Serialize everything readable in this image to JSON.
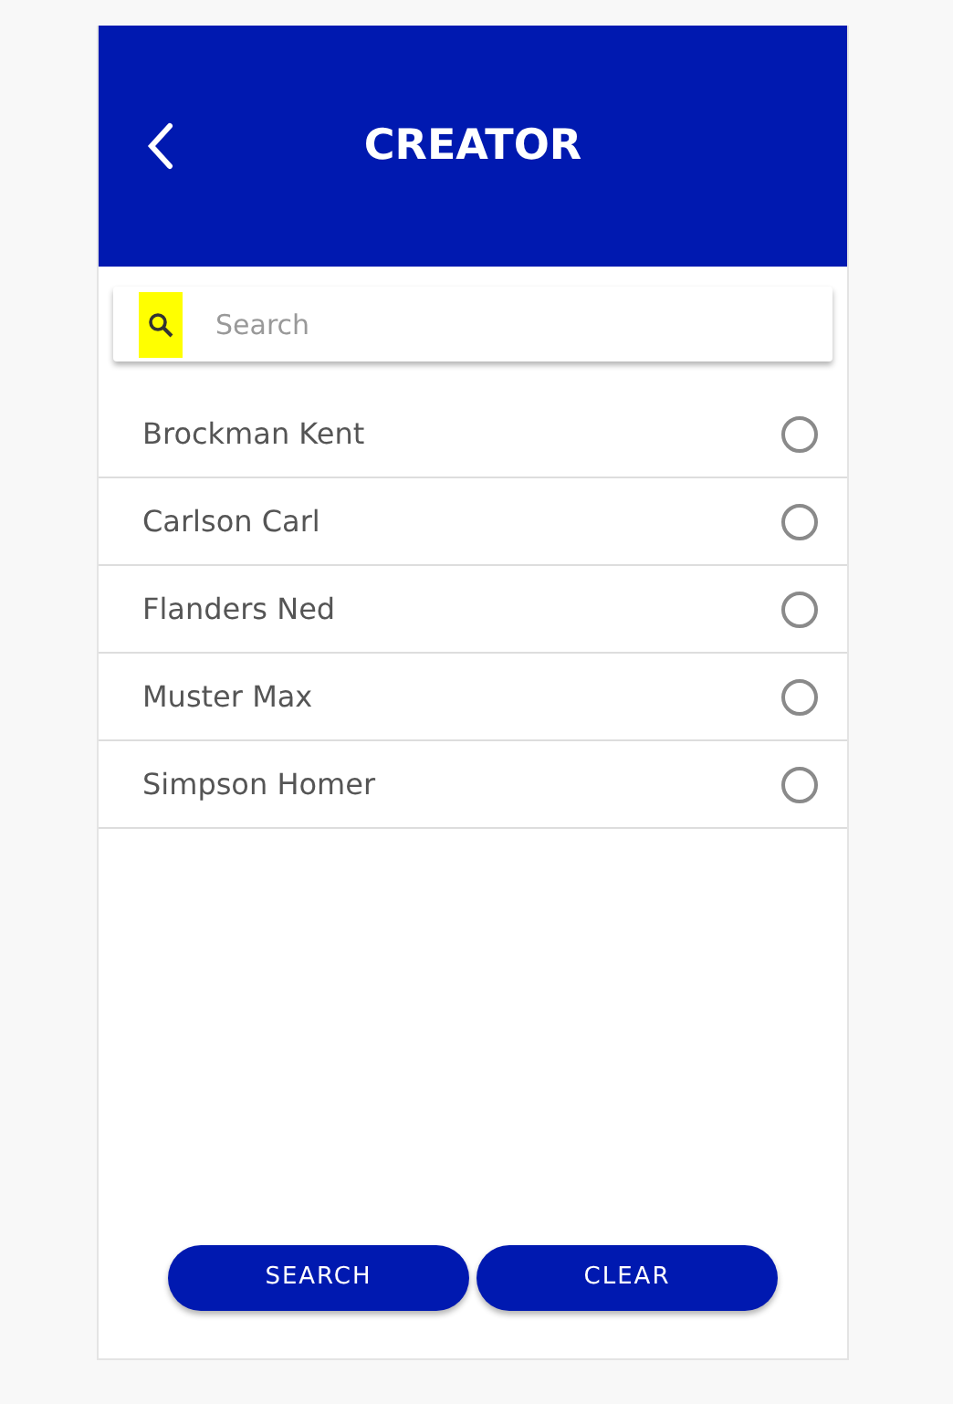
{
  "header": {
    "title": "CREATOR"
  },
  "search": {
    "placeholder": "Search",
    "icon_highlighted": true
  },
  "items": [
    {
      "name": "Brockman Kent",
      "selected": false
    },
    {
      "name": "Carlson Carl",
      "selected": false
    },
    {
      "name": "Flanders Ned",
      "selected": false
    },
    {
      "name": "Muster Max",
      "selected": false
    },
    {
      "name": "Simpson Homer",
      "selected": false
    }
  ],
  "buttons": [
    "SEARCH",
    "CLEAR"
  ]
}
